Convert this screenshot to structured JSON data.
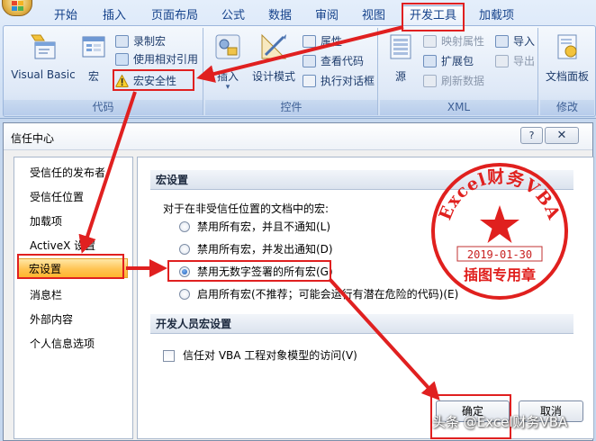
{
  "ribbon": {
    "tabs": [
      "开始",
      "插入",
      "页面布局",
      "公式",
      "数据",
      "审阅",
      "视图",
      "开发工具",
      "加载项"
    ],
    "active_tab": "开发工具",
    "groups": {
      "code": {
        "label": "代码",
        "visual_basic": "Visual Basic",
        "macros": "宏",
        "record_macro": "录制宏",
        "relative_ref": "使用相对引用",
        "macro_security": "宏安全性"
      },
      "controls": {
        "label": "控件",
        "insert": "插入",
        "design_mode": "设计模式",
        "properties": "属性",
        "view_code": "查看代码",
        "run_dialog": "执行对话框"
      },
      "xml": {
        "label": "XML",
        "source": "源",
        "map_props": "映射属性",
        "expansion_packs": "扩展包",
        "refresh_data": "刷新数据",
        "import": "导入",
        "export": "导出"
      },
      "modify": {
        "label": "修改",
        "doc_panel": "文档面板"
      }
    }
  },
  "dialog": {
    "title": "信任中心",
    "help_btn": "?",
    "close_btn": "✕",
    "nav": [
      "受信任的发布者",
      "受信任位置",
      "加载项",
      "ActiveX 设置",
      "宏设置",
      "消息栏",
      "外部内容",
      "个人信息选项"
    ],
    "selected_nav": "宏设置",
    "macro_section": {
      "heading": "宏设置",
      "subtitle": "对于在非受信任位置的文档中的宏:",
      "options": [
        "禁用所有宏，并且不通知(L)",
        "禁用所有宏，并发出通知(D)",
        "禁用无数字签署的所有宏(G)",
        "启用所有宏(不推荐；可能会运行有潜在危险的代码)(E)"
      ],
      "selected_option": 2
    },
    "dev_section": {
      "heading": "开发人员宏设置",
      "trust_vba": "信任对 VBA 工程对象模型的访问(V)",
      "trust_vba_checked": false
    },
    "ok_button": "确定",
    "cancel_button": "取消"
  },
  "stamp": {
    "top_text": "Excel财务VBA",
    "date": "2019-01-30",
    "bottom_text": "插图专用章",
    "color": "#e0201e"
  },
  "watermark": "头条 @Excel财务VBA",
  "colors": {
    "annotation_red": "#e02020",
    "ribbon_text": "#15428b",
    "selected_nav": "#ffc453"
  }
}
